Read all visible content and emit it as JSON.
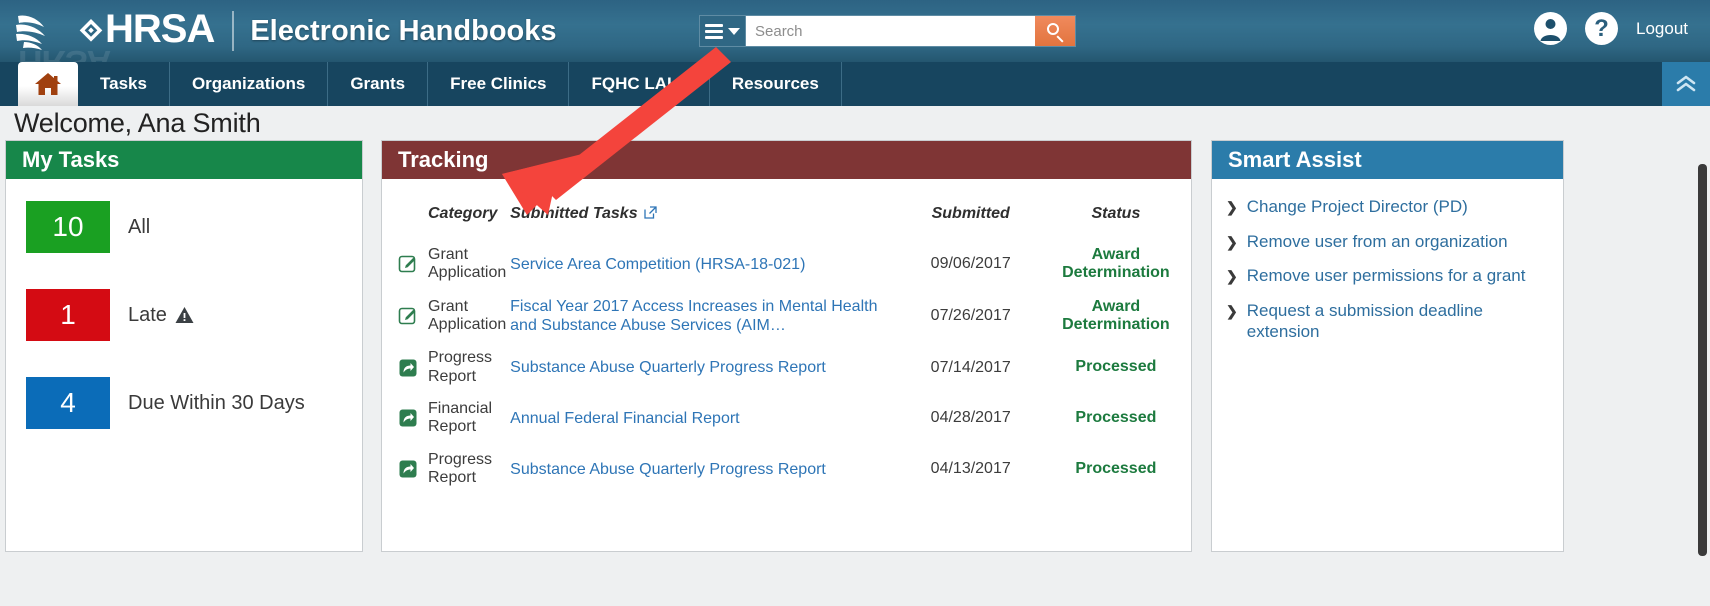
{
  "header": {
    "logo_text": "HRSA",
    "app_title": "Electronic Handbooks",
    "search": {
      "placeholder": "Search",
      "value": "",
      "menu_icon": "hamburger-icon",
      "submit_icon": "search-icon"
    },
    "account_icon": "user-account-icon",
    "help_icon": "help-question-icon",
    "logout_label": "Logout"
  },
  "nav": {
    "home_icon": "home-icon",
    "collapse_icon": "chevron-double-up-icon",
    "tabs": [
      {
        "label": "Tasks"
      },
      {
        "label": "Organizations"
      },
      {
        "label": "Grants"
      },
      {
        "label": "Free Clinics"
      },
      {
        "label": "FQHC LALs"
      },
      {
        "label": "Resources"
      }
    ]
  },
  "welcome": "Welcome, Ana Smith",
  "my_tasks": {
    "title": "My Tasks",
    "header_color": "#17874a",
    "items": [
      {
        "count": "10",
        "label": "All",
        "color": "#1aa022",
        "warning": false
      },
      {
        "count": "1",
        "label": "Late",
        "color": "#d40b13",
        "warning": true
      },
      {
        "count": "4",
        "label": "Due Within 30 Days",
        "color": "#0b6cb8",
        "warning": false
      }
    ]
  },
  "tracking": {
    "title": "Tracking",
    "header_color": "#7f3535",
    "columns": {
      "category": "Category",
      "submitted_tasks": "Submitted Tasks",
      "submitted": "Submitted",
      "status": "Status"
    },
    "external_link_icon": "external-link-icon",
    "rows": [
      {
        "icon": "edit-document-icon",
        "category": "Grant Application",
        "task": "Service Area Competition (HRSA-18-021)",
        "submitted": "09/06/2017",
        "status": "Award Determination"
      },
      {
        "icon": "edit-document-icon",
        "category": "Grant Application",
        "task": "Fiscal Year 2017 Access Increases in Mental Health and Substance Abuse Services (AIM…",
        "submitted": "07/26/2017",
        "status": "Award Determination"
      },
      {
        "icon": "submitted-report-icon",
        "category": "Progress Report",
        "task": "Substance Abuse Quarterly Progress Report",
        "submitted": "07/14/2017",
        "status": "Processed"
      },
      {
        "icon": "submitted-report-icon",
        "category": "Financial Report",
        "task": "Annual Federal Financial Report",
        "submitted": "04/28/2017",
        "status": "Processed"
      },
      {
        "icon": "submitted-report-icon",
        "category": "Progress Report",
        "task": "Substance Abuse Quarterly Progress Report",
        "submitted": "04/13/2017",
        "status": "Processed"
      }
    ]
  },
  "smart_assist": {
    "title": "Smart Assist",
    "header_color": "#2b7caa",
    "items": [
      {
        "label": "Change Project Director (PD)"
      },
      {
        "label": "Remove user from an organization"
      },
      {
        "label": "Remove user permissions for a grant"
      },
      {
        "label": "Request a submission deadline extension"
      }
    ]
  },
  "annotation": {
    "arrow_color": "#f4443c"
  }
}
